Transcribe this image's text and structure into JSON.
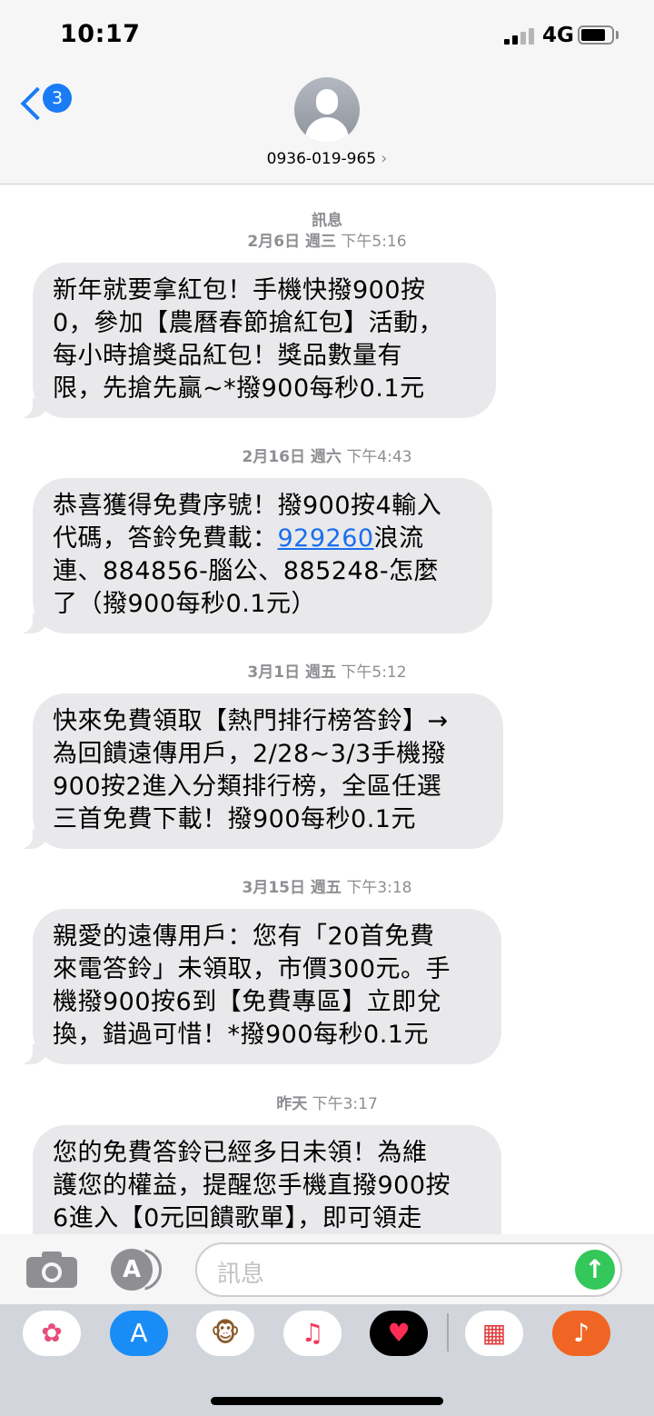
{
  "status_bar": {
    "time": "10:17",
    "network": "4G"
  },
  "header": {
    "back_badge_count": "3",
    "contact_name": "0936-019-965",
    "chevron": "›"
  },
  "thread": {
    "section_title": "訊息",
    "messages": [
      {
        "stamp_date": "2月6日 週三",
        "stamp_time": "下午5:16",
        "lines": [
          "新年就要拿紅包！手機快撥900按",
          "0，參加【農曆春節搶紅包】活動，",
          "每小時搶獎品紅包！獎品數量有",
          "限，先搶先贏~*撥900每秒0.1元"
        ]
      },
      {
        "stamp_date": "2月16日 週六",
        "stamp_time": "下午4:43",
        "line1": "恭喜獲得免費序號！撥900按4輸入",
        "line2_before": "代碼，答鈴免費載：",
        "line2_link": "929260",
        "line2_after": "浪流",
        "line3": "連、884856-腦公、885248-怎麼",
        "line4": "了（撥900每秒0.1元）"
      },
      {
        "stamp_date": "3月1日 週五",
        "stamp_time": "下午5:12",
        "lines": [
          "快來免費領取【熱門排行榜答鈴】→",
          "為回饋遠傳用戶，2/28~3/3手機撥",
          "900按2進入分類排行榜，全區任選",
          "三首免費下載！撥900每秒0.1元"
        ]
      },
      {
        "stamp_date": "3月15日 週五",
        "stamp_time": "下午3:18",
        "lines": [
          "親愛的遠傳用戶：您有「20首免費",
          "來電答鈴」未領取，市價300元。手",
          "機撥900按6到【免費專區】立即兌",
          "換，錯過可惜！*撥900每秒0.1元"
        ]
      },
      {
        "stamp_date": "昨天",
        "stamp_time": "下午3:17",
        "lines": [
          "您的免費答鈴已經多日未領！為維",
          "護您的權益，提醒您手機直撥900按",
          "6進入【0元回饋歌單】，即可領走"
        ]
      }
    ]
  },
  "compose": {
    "placeholder": "訊息",
    "send_icon": "↑",
    "apps_icon": "A"
  },
  "drawer": {
    "apps": [
      {
        "name": "photos-app-icon",
        "glyph": "✿",
        "bg": "#ffffff",
        "color": "#e84c7a"
      },
      {
        "name": "app-store-icon",
        "glyph": "A",
        "bg": "#1a8cf5",
        "color": "#ffffff"
      },
      {
        "name": "animoji-icon",
        "glyph": "🐵",
        "bg": "#ffffff",
        "color": "#8a5a2b"
      },
      {
        "name": "music-icon",
        "glyph": "♫",
        "bg": "#ffffff",
        "color": "#f2385a"
      },
      {
        "name": "digital-touch-icon",
        "glyph": "♥",
        "bg": "#000000",
        "color": "#ff2d55"
      },
      {
        "name": "calendar-sticker-icon",
        "glyph": "▦",
        "bg": "#ffffff",
        "color": "#e23b3b"
      },
      {
        "name": "garageband-icon",
        "glyph": "♪",
        "bg": "#f06523",
        "color": "#ffffff"
      }
    ]
  },
  "colors": {
    "accent": "#1a7cf5",
    "bubble": "#e9e9eb",
    "send": "#34c759",
    "meta": "#8e8e93"
  }
}
